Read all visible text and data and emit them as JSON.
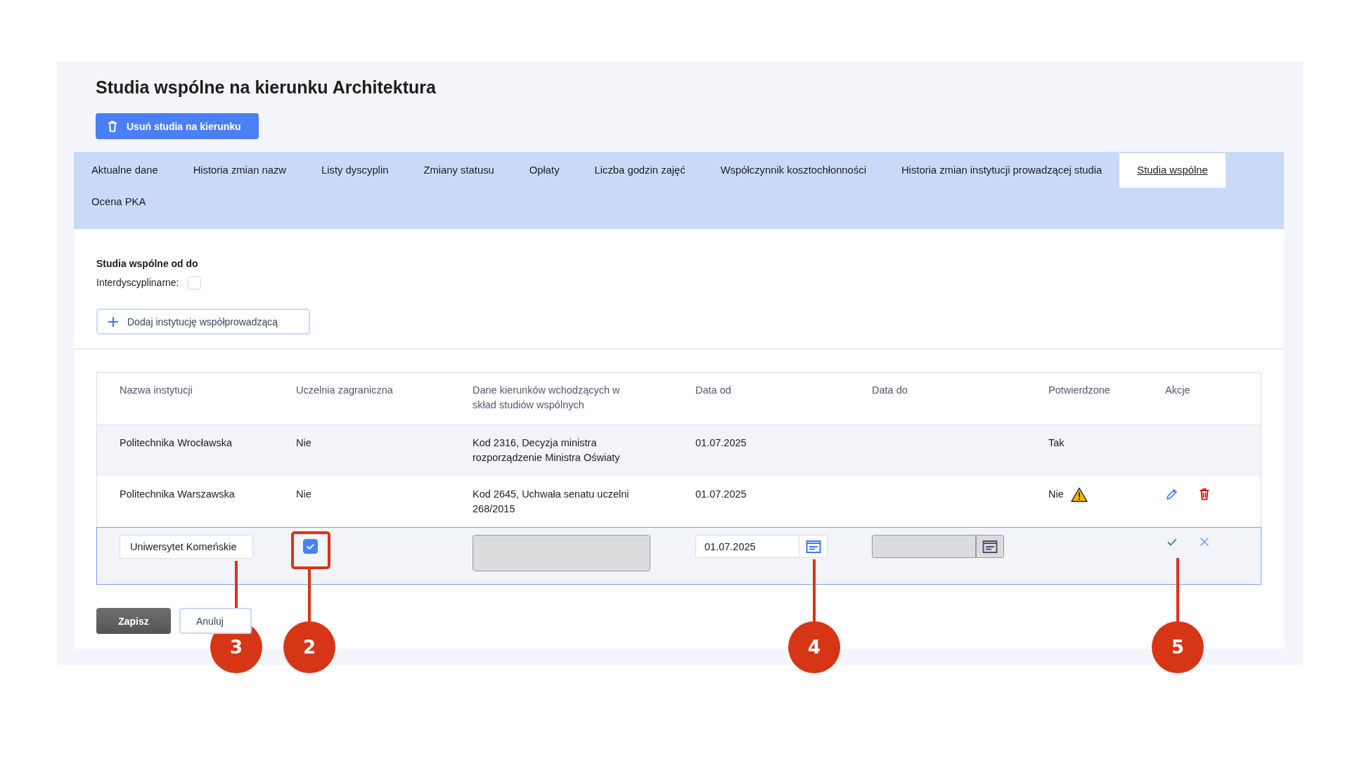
{
  "title": "Studia wspólne na kierunku Architektura",
  "delete_button": {
    "label": "Usuń studia na kierunku"
  },
  "tabs": [
    {
      "label": "Aktualne dane",
      "selected": false
    },
    {
      "label": "Historia zmian nazw",
      "selected": false
    },
    {
      "label": "Listy dyscyplin",
      "selected": false
    },
    {
      "label": "Zmiany statusu",
      "selected": false
    },
    {
      "label": "Opłaty",
      "selected": false
    },
    {
      "label": "Liczba godzin zajęć",
      "selected": false
    },
    {
      "label": "Współczynnik kosztochłonności",
      "selected": false
    },
    {
      "label": "Historia zmian instytucji prowadzącej studia",
      "selected": false
    },
    {
      "label": "Studia wspólne",
      "selected": true
    },
    {
      "label": "Ocena PKA",
      "selected": false
    }
  ],
  "section_title": "Studia wspólne od do",
  "interdisciplinary": {
    "label": "Interdyscyplinarne:",
    "checked": false
  },
  "add_button": {
    "label": "Dodaj instytucję współprowadzącą"
  },
  "table": {
    "columns": [
      "Nazwa instytucji",
      "Uczelnia zagraniczna",
      "Dane kierunków wchodzących w skład studiów wspólnych",
      "Data od",
      "Data do",
      "Potwierdzone",
      "Akcje"
    ],
    "rows": [
      {
        "institution": "Politechnika Wrocławska",
        "foreign": "Nie",
        "programs": "Kod 2316, Decyzja ministra rozporządzenie Ministra Oświaty",
        "date_from": "01.07.2025",
        "confirmed": "Tak",
        "warning": false
      },
      {
        "institution": "Politechnika Warszawska",
        "foreign": "Nie",
        "programs": "Kod 2645, Uchwała senatu uczelni 268/2015",
        "date_from": "01.07.2025",
        "confirmed": "Nie",
        "warning": true,
        "actions": [
          {
            "kind": "edit"
          },
          {
            "kind": "delete"
          }
        ]
      }
    ],
    "edit_row": {
      "institution": {
        "value": "Uniwersytet Komeńskie"
      },
      "foreign": {
        "checked": true
      },
      "programs": {
        "disabled": true
      },
      "date_from": {
        "value": "01.07.2025",
        "disabled": false
      },
      "date_to": {
        "disabled": true
      },
      "actions": [
        {
          "kind": "confirm"
        },
        {
          "kind": "cancel"
        }
      ]
    }
  },
  "buttons": [
    {
      "label": "Zapisz",
      "kind": "primary"
    },
    {
      "label": "Anuluj",
      "kind": "secondary"
    }
  ],
  "callouts": [
    {
      "label": "3",
      "highlight": false
    },
    {
      "label": "2",
      "highlight": true
    },
    {
      "label": "4",
      "highlight": false
    },
    {
      "label": "5",
      "highlight": false
    }
  ]
}
